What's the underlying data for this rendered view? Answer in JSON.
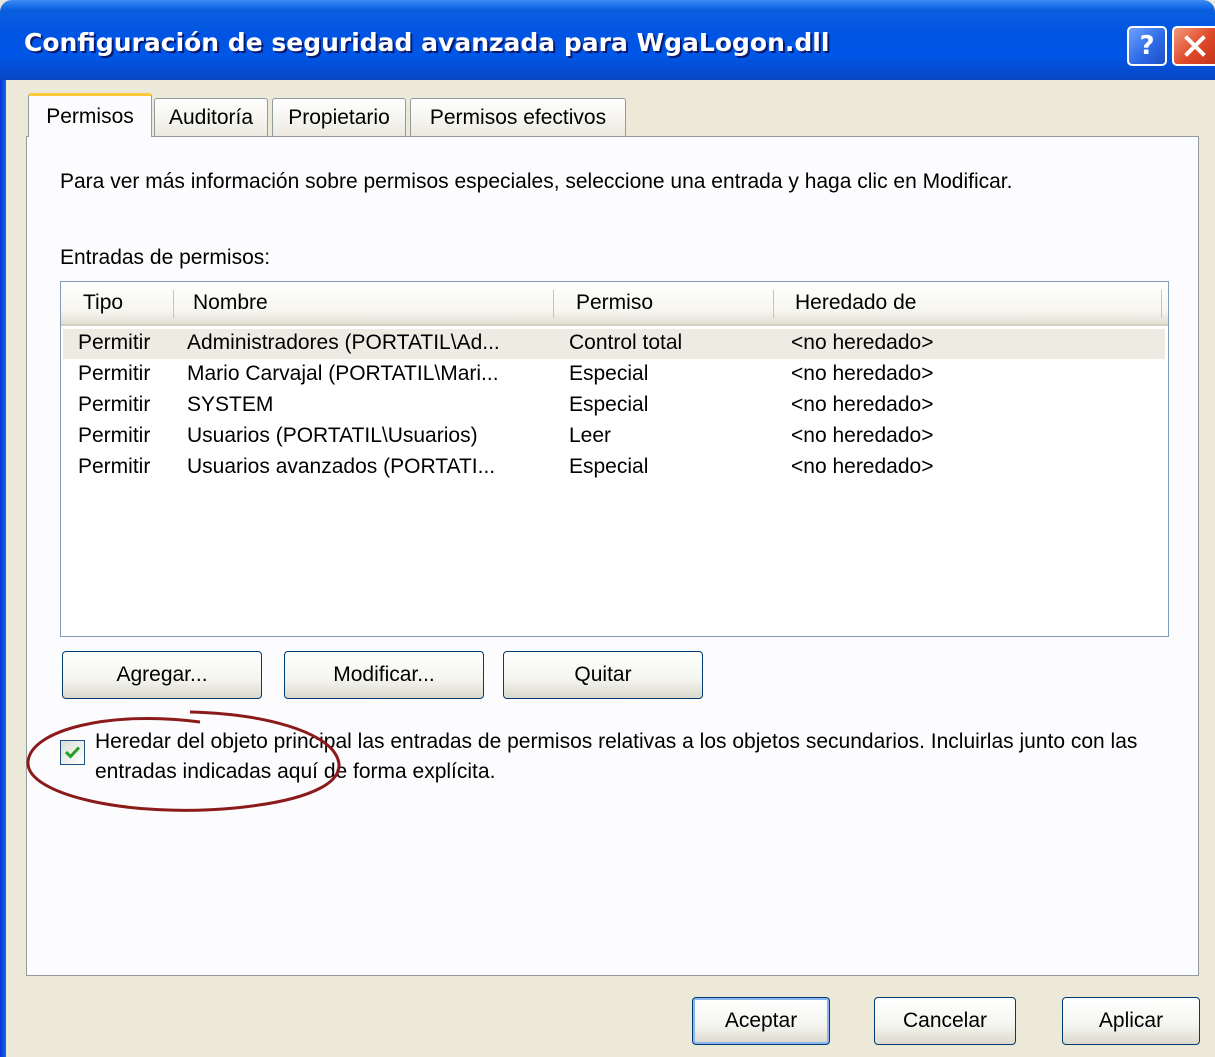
{
  "window": {
    "title": "Configuración de seguridad avanzada para WgaLogon.dll",
    "help_label": "?"
  },
  "tabs": [
    {
      "label": "Permisos",
      "active": true
    },
    {
      "label": "Auditoría",
      "active": false
    },
    {
      "label": "Propietario",
      "active": false
    },
    {
      "label": "Permisos efectivos",
      "active": false
    }
  ],
  "permisos": {
    "info_text": "Para ver más información sobre permisos especiales, seleccione una entrada y haga clic en Modificar.",
    "entries_label": "Entradas de permisos:",
    "columns": [
      "Tipo",
      "Nombre",
      "Permiso",
      "Heredado de"
    ],
    "rows": [
      {
        "tipo": "Permitir",
        "nombre": "Administradores (PORTATIL\\Ad...",
        "permiso": "Control total",
        "heredado": "<no heredado>"
      },
      {
        "tipo": "Permitir",
        "nombre": "Mario Carvajal (PORTATIL\\Mari...",
        "permiso": "Especial",
        "heredado": "<no heredado>"
      },
      {
        "tipo": "Permitir",
        "nombre": "SYSTEM",
        "permiso": "Especial",
        "heredado": "<no heredado>"
      },
      {
        "tipo": "Permitir",
        "nombre": "Usuarios (PORTATIL\\Usuarios)",
        "permiso": "Leer",
        "heredado": "<no heredado>"
      },
      {
        "tipo": "Permitir",
        "nombre": "Usuarios avanzados (PORTATI...",
        "permiso": "Especial",
        "heredado": "<no heredado>"
      }
    ],
    "add_label": "Agregar...",
    "modify_label": "Modificar...",
    "remove_label": "Quitar",
    "inherit_checked": true,
    "inherit_label": "Heredar del objeto principal las entradas de permisos relativas a los objetos secundarios. Incluirlas junto con las entradas indicadas aquí de forma explícita."
  },
  "footer": {
    "ok_label": "Aceptar",
    "cancel_label": "Cancelar",
    "apply_label": "Aplicar"
  },
  "colors": {
    "titlebar": "#0054e3",
    "dialog_bg": "#ece9d8",
    "annotation": "#8b1a1a",
    "checkmark": "#21a121"
  }
}
